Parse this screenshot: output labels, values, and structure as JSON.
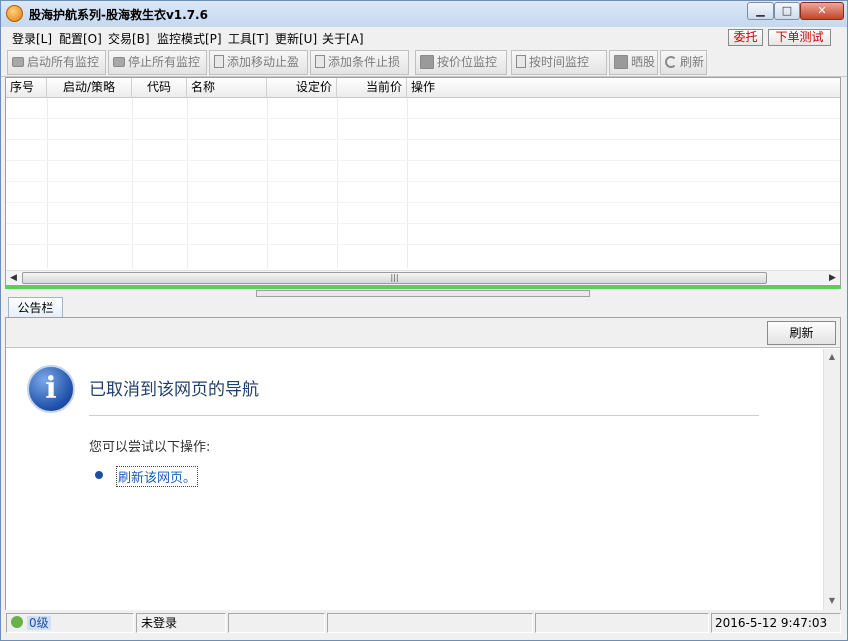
{
  "window": {
    "title": "股海护航系列-股海救生衣v1.7.6"
  },
  "menu": {
    "items": [
      "登录[L]",
      "配置[O]",
      "交易[B]",
      "监控模式[P]",
      "工具[T]",
      "更新[U]",
      "关于[A]"
    ],
    "entrust": "委托",
    "test_order": "下单测试"
  },
  "toolbar": {
    "buttons": [
      "启动所有监控",
      "停止所有监控",
      "添加移动止盈",
      "添加条件止损",
      "按价位监控",
      "按时间监控",
      "晒股",
      "刷新"
    ]
  },
  "table": {
    "columns": [
      "序号",
      "启动/策略",
      "代码",
      "名称",
      "设定价",
      "当前价",
      "操作"
    ],
    "rows": []
  },
  "notice": {
    "tab_label": "公告栏",
    "refresh_label": "刷新",
    "error_title": "已取消到该网页的导航",
    "try_text": "您可以尝试以下操作:",
    "link_text": "刷新该网页。"
  },
  "status": {
    "level": "0级",
    "login_state": "未登录",
    "datetime": "2016-5-12  9:47:03"
  },
  "colors": {
    "accent_red": "#c80000",
    "progress_green": "#5ad05a",
    "info_blue": "#1e4ea6"
  }
}
